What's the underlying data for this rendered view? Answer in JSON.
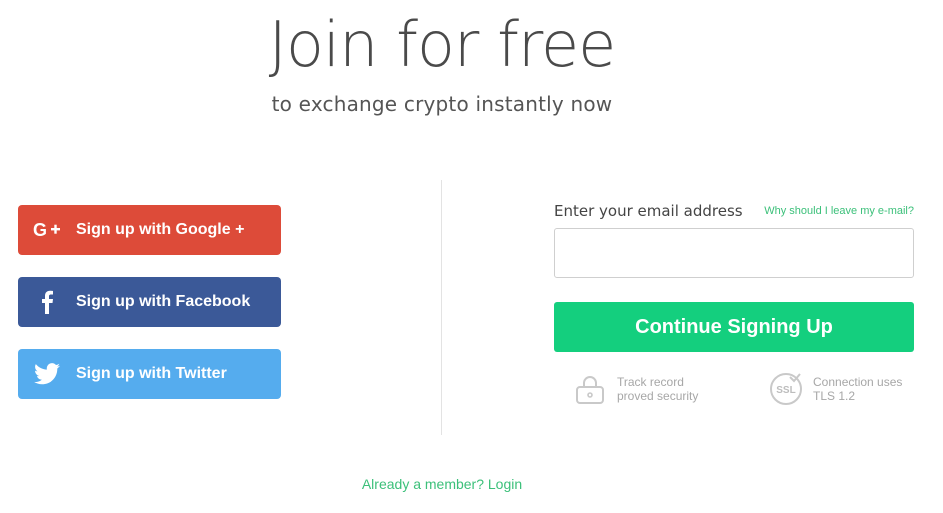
{
  "header": {
    "title": "Join for free",
    "subtitle": "to exchange crypto instantly now"
  },
  "social": {
    "google_label": "Sign up with Google +",
    "google_icon": "google-plus-icon",
    "facebook_label": "Sign up with Facebook",
    "facebook_icon": "facebook-icon",
    "twitter_label": "Sign up with Twitter",
    "twitter_icon": "twitter-icon",
    "colors": {
      "google": "#dd4b39",
      "facebook": "#3b5998",
      "twitter": "#55acee"
    }
  },
  "email_form": {
    "label": "Enter your email address",
    "why_link": "Why should I leave my e-mail?",
    "input_value": "",
    "input_placeholder": "",
    "continue_label": "Continue Signing Up",
    "accent": "#14cf7e"
  },
  "features": {
    "security_line1": "Track record",
    "security_line2": "proved security",
    "security_icon": "lock-icon",
    "ssl_line1": "Connection uses",
    "ssl_line2": "TLS 1.2",
    "ssl_icon": "ssl-badge-icon",
    "ssl_badge_text": "SSL"
  },
  "footer": {
    "login_text": "Already a member? Login"
  }
}
